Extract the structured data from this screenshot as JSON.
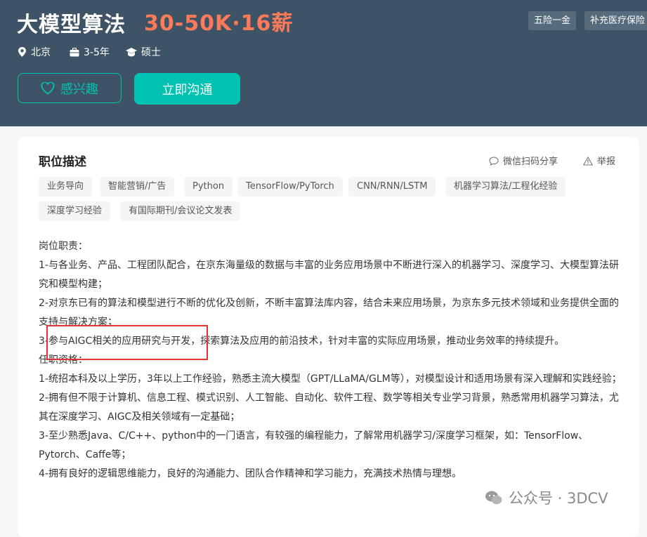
{
  "header": {
    "job_title": "大模型算法",
    "salary": "30-50K·16薪",
    "benefits": [
      "五险一金",
      "补充医疗保险"
    ],
    "location": "北京",
    "experience": "3-5年",
    "degree": "硕士",
    "interest_button": "感兴趣",
    "chat_button": "立即沟通"
  },
  "card": {
    "title": "职位描述",
    "share_label": "微信扫码分享",
    "report_label": "举报",
    "skills": [
      "业务导向",
      "智能营销/广告",
      "Python",
      "TensorFlow/PyTorch",
      "CNN/RNN/LSTM",
      "机器学习算法/工程化经验",
      "深度学习经验",
      "有国际期刊/会议论文发表"
    ],
    "description": [
      "岗位职责：",
      "1-与各业务、产品、工程团队配合，在京东海量级的数据与丰富的业务应用场景中不断进行深入的机器学习、深度学习、大模型算法研究和模型构建；",
      "2-对京东已有的算法和模型进行不断的优化及创新，不断丰富算法库内容，结合未来应用场景，为京东多元技术领域和业务提供全面的支持与解决方案；",
      "3-参与AIGC相关的应用研究与开发，探索算法及应用的前沿技术，针对丰富的实际应用场景，推动业务效率的持续提升。",
      "任职资格：",
      "1-统招本科及以上学历，3年以上工作经验，熟悉主流大模型（GPT/LLaMA/GLM等），对模型设计和适用场景有深入理解和实践经验；",
      "2-拥有但不限于计算机、信息工程、模式识别、人工智能、自动化、软件工程、数学等相关专业学习背景，熟悉常用机器学习算法，尤其在深度学习、AIGC及相关领域有一定基础；",
      "3-至少熟悉Java、C/C++、python中的一门语言，有较强的编程能力，了解常用机器学习/深度学习框架，如：TensorFlow、Pytorch、Caffe等；",
      "4-拥有良好的逻辑思维能力，良好的沟通能力、团队合作精神和学习能力，充满技术热情与理想。"
    ]
  },
  "watermark": "公众号 · 3DCV",
  "colors": {
    "header_bg": "#3e5466",
    "accent": "#00c2b3",
    "salary": "#ff7a59",
    "highlight_box": "#e23333"
  },
  "icons": [
    "location-icon",
    "briefcase-icon",
    "graduation-cap-icon",
    "heart-icon",
    "chat-bubble-icon",
    "warning-icon",
    "wechat-icon"
  ]
}
